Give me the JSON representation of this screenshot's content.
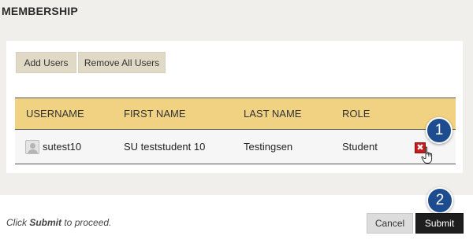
{
  "section": {
    "title": "MEMBERSHIP"
  },
  "toolbar": {
    "add_users_label": "Add Users",
    "remove_all_label": "Remove All Users"
  },
  "table": {
    "headers": {
      "username": "USERNAME",
      "first_name": "FIRST NAME",
      "last_name": "LAST NAME",
      "role": "ROLE"
    },
    "rows": [
      {
        "username": "sutest10",
        "first_name": "SU teststudent 10",
        "last_name": "Testingsen",
        "role": "Student",
        "delete_icon": "x-icon"
      }
    ]
  },
  "callouts": {
    "step1": "1",
    "step2": "2"
  },
  "footer": {
    "hint_prefix": "Click ",
    "hint_bold": "Submit",
    "hint_suffix": " to proceed.",
    "cancel_label": "Cancel",
    "submit_label": "Submit"
  },
  "colors": {
    "header_bg": "#f0d282",
    "delete_red": "#c41b1b",
    "callout_blue": "#1d4c8f",
    "submit_bg": "#1e1e1e"
  }
}
